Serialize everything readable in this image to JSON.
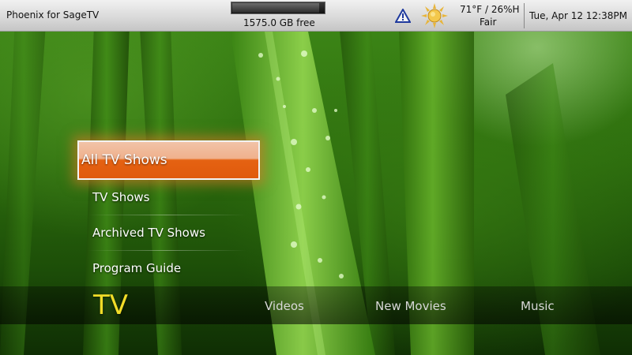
{
  "topbar": {
    "app_title": "Phoenix for SageTV",
    "disk_free": "1575.0 GB free",
    "disk_used_fraction": 0.95,
    "temperature_humidity": "71°F / 26%H",
    "weather_condition": "Fair",
    "datetime": "Tue, Apr 12  12:38PM"
  },
  "icons": {
    "warning": "warning-icon",
    "weather": "sun-icon"
  },
  "submenu": {
    "items": [
      {
        "label": "All TV Shows",
        "selected": true
      },
      {
        "label": "TV Shows"
      },
      {
        "label": "Archived TV Shows"
      },
      {
        "label": "Program Guide"
      }
    ]
  },
  "mainmenu": {
    "items": [
      {
        "label": "TV",
        "active": true
      },
      {
        "label": "Videos"
      },
      {
        "label": "New Movies"
      },
      {
        "label": "Music"
      }
    ]
  },
  "colors": {
    "accent_orange": "#e05a0c",
    "active_yellow": "#f1dc28"
  }
}
